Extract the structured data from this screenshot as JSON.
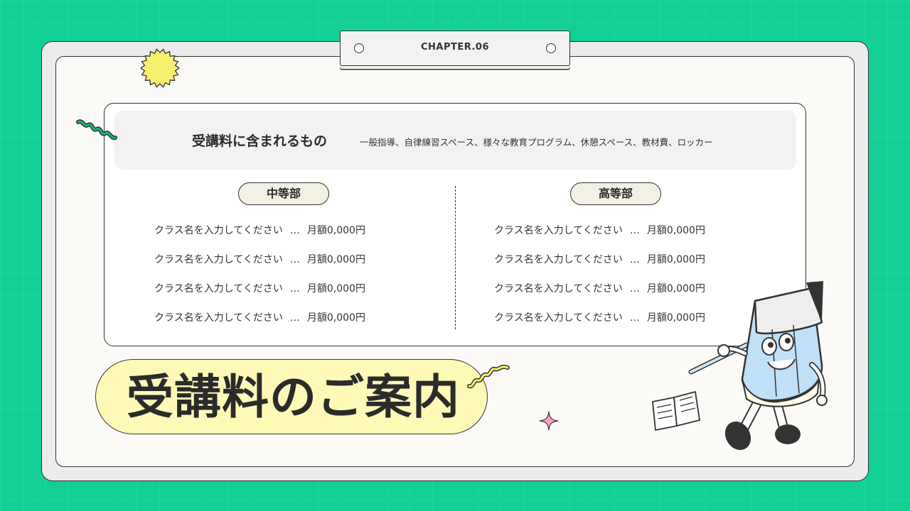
{
  "chapter_label": "CHAPTER.06",
  "included": {
    "title": "受講料に含まれるもの",
    "items": "一般指導、自律練習スペース、様々な教育プログラム、休憩スペース、教材費、ロッカー"
  },
  "divisions": [
    {
      "name": "中等部",
      "classes": [
        {
          "name": "クラス名を入力してください",
          "sep": "…",
          "price": "月額0,000円"
        },
        {
          "name": "クラス名を入力してください",
          "sep": "…",
          "price": "月額0,000円"
        },
        {
          "name": "クラス名を入力してください",
          "sep": "…",
          "price": "月額0,000円"
        },
        {
          "name": "クラス名を入力してください",
          "sep": "…",
          "price": "月額0,000円"
        }
      ]
    },
    {
      "name": "高等部",
      "classes": [
        {
          "name": "クラス名を入力してください",
          "sep": "…",
          "price": "月額0,000円"
        },
        {
          "name": "クラス名を入力してください",
          "sep": "…",
          "price": "月額0,000円"
        },
        {
          "name": "クラス名を入力してください",
          "sep": "…",
          "price": "月額0,000円"
        },
        {
          "name": "クラス名を入力してください",
          "sep": "…",
          "price": "月額0,000円"
        }
      ]
    }
  ],
  "page_title": "受講料のご案内",
  "colors": {
    "background": "#12cf96",
    "title_pill": "#fff9b8",
    "sun": "#f7ef6e",
    "sparkle": "#f4a6c6",
    "pencil_body": "#bfe0f7"
  },
  "icons": [
    "sun-sticker-icon",
    "squiggle-icon",
    "sparkle-icon",
    "open-book-icon",
    "pencil-mascot-icon"
  ]
}
